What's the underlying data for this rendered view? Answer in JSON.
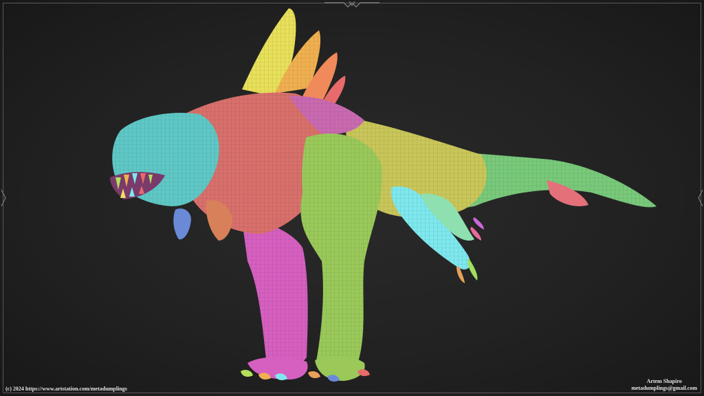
{
  "copyright": "(c) 2024 https://www.artstation.com/metadumplings",
  "artist": {
    "name": "Artem Shapiro",
    "email": "metadumplings@gmail.com"
  },
  "colors": {
    "background": "#222222",
    "head": "#5fc8c6",
    "torso": "#d8706b",
    "shoulder": "#c96ab0",
    "front_leg": "#9ac95a",
    "back_leg": "#d660c0",
    "spine_fin": "#e8e05a",
    "tail": "#79c97a",
    "arm": "#7ee8ee"
  }
}
